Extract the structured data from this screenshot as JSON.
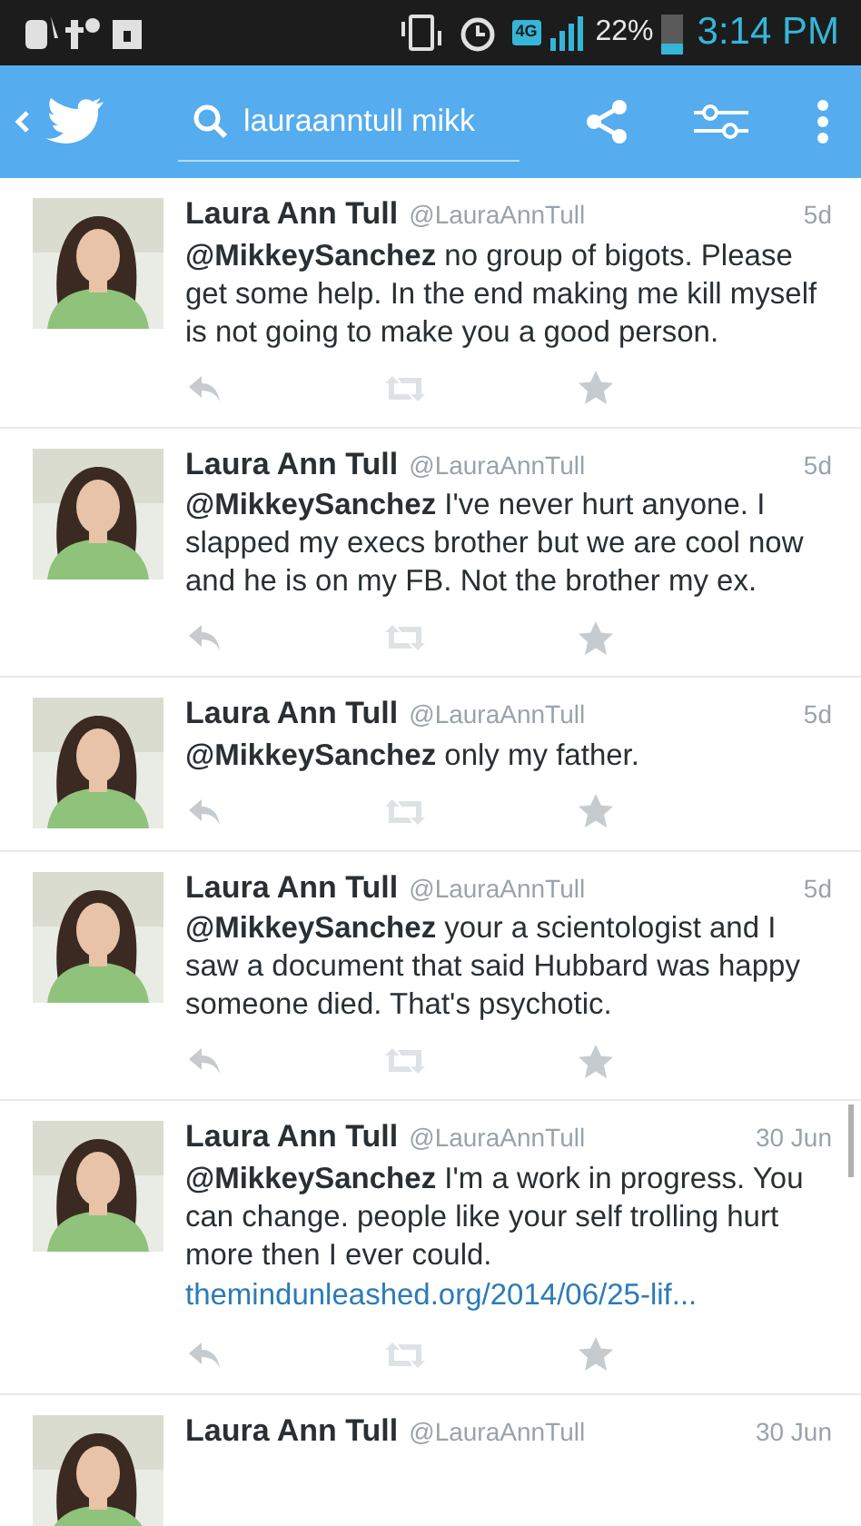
{
  "status_bar": {
    "network": "4G",
    "battery": "22%",
    "time": "3:14 PM"
  },
  "app_bar": {
    "search": {
      "value": "lauraanntull mikk"
    }
  },
  "tweets": [
    {
      "name": "Laura Ann Tull",
      "handle": "@LauraAnnTull",
      "time": "5d",
      "text": "**@MikkeySanchez** no group of bigots. Please get some help. In the end making me kill myself is not going to make you a good person."
    },
    {
      "name": "Laura Ann Tull",
      "handle": "@LauraAnnTull",
      "time": "5d",
      "text": "**@MikkeySanchez** I've never hurt anyone. I slapped my execs brother but we are cool now and he is on my FB. Not the brother my ex."
    },
    {
      "name": "Laura Ann Tull",
      "handle": "@LauraAnnTull",
      "time": "5d",
      "text": "**@MikkeySanchez** only my father."
    },
    {
      "name": "Laura Ann Tull",
      "handle": "@LauraAnnTull",
      "time": "5d",
      "text": "**@MikkeySanchez** your a scientologist and I saw a document that said Hubbard was happy someone died. That's psychotic."
    },
    {
      "name": "Laura Ann Tull",
      "handle": "@LauraAnnTull",
      "time": "30 Jun",
      "text": "**@MikkeySanchez** I'm a work in progress. You can change. people like your self trolling hurt more then I ever could.",
      "link": "themindunleashed.org/2014/06/25-lif..."
    },
    {
      "name": "Laura Ann Tull",
      "handle": "@LauraAnnTull",
      "time": "30 Jun"
    }
  ]
}
